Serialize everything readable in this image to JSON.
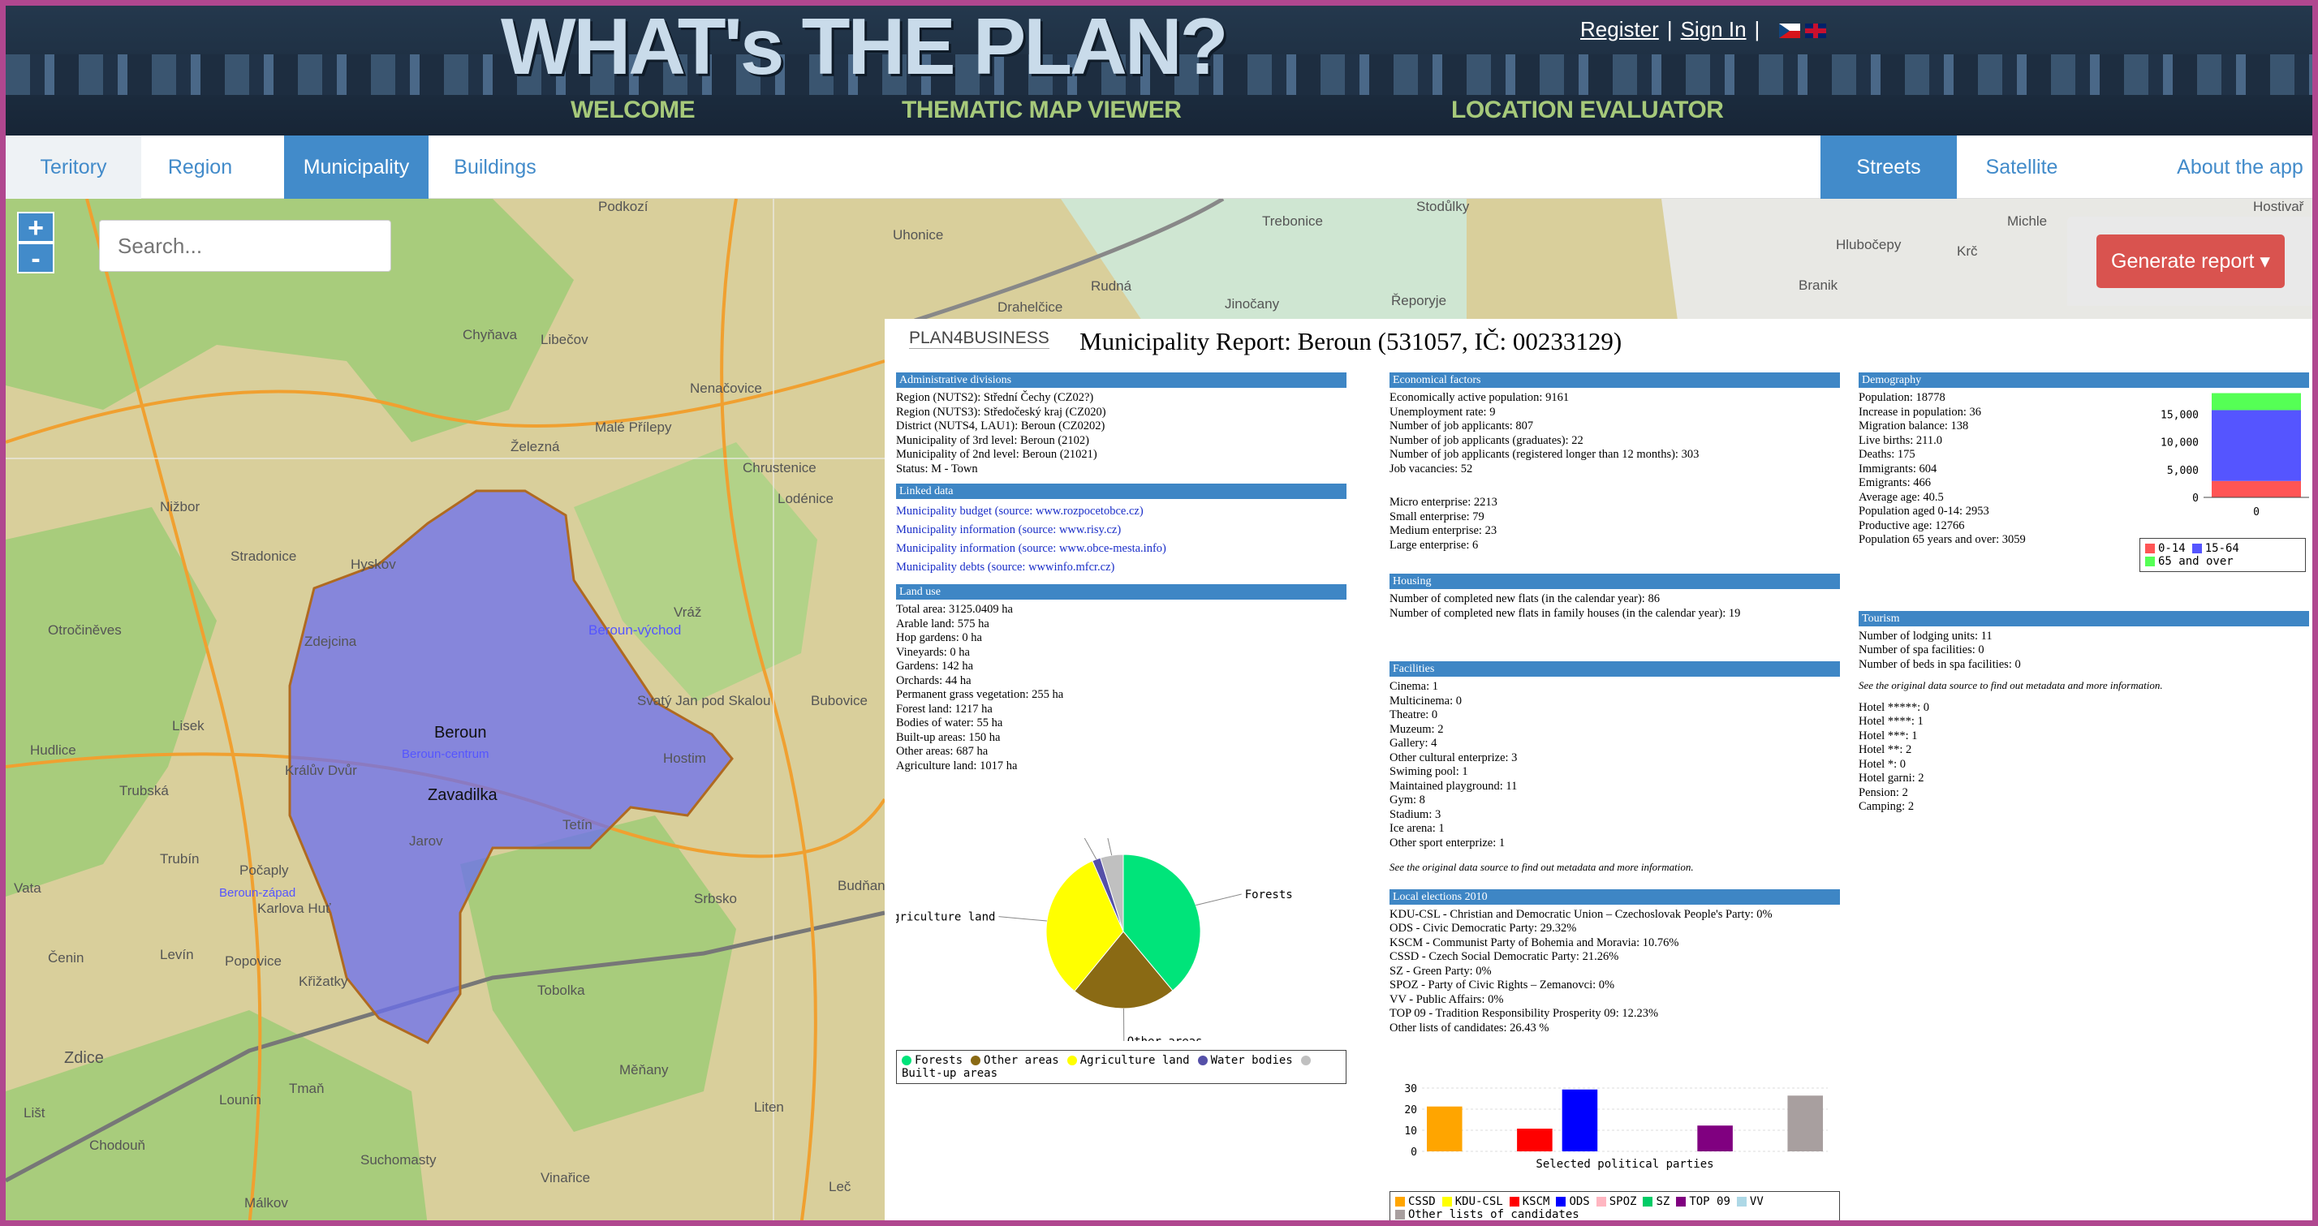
{
  "header": {
    "site_title": "WHAT's THE PLAN?",
    "register": "Register",
    "signin": "Sign In",
    "sep1": "|",
    "sep2": "|",
    "nav": [
      "WELCOME",
      "THEMATIC MAP VIEWER",
      "LOCATION EVALUATOR"
    ]
  },
  "tabs": {
    "left": [
      "Teritory",
      "Region",
      "Municipality",
      "Buildings"
    ],
    "right": [
      "Streets",
      "Satellite",
      "About the app"
    ]
  },
  "map": {
    "search_placeholder": "Search...",
    "zoom_in": "+",
    "zoom_out": "-",
    "generate_report": "Generate report ▾",
    "labels": [
      "Podkozí",
      "Uhonice",
      "Chyňava",
      "Libečov",
      "Nenačovice",
      "Malé Přílepy",
      "Železná",
      "Nižbor",
      "Stradonice",
      "Hyskov",
      "Chrustenice",
      "Lodénice",
      "Otročiněves",
      "Zdejcina",
      "Vráž",
      "Beroun",
      "Beroun-východ",
      "Svatý Jan pod Skalou",
      "Bubovice",
      "Hudlice",
      "Trubská",
      "Zavadilka",
      "Hostim",
      "Králův Dvůr",
      "Jarov",
      "Tetín",
      "Trubín",
      "Počaply",
      "Karlova Huť",
      "Srbsko",
      "Levín",
      "Popovice",
      "Křižatky",
      "Tobolka",
      "Zdice",
      "Měňany",
      "Lounín",
      "Tmaň",
      "Chodouň",
      "Suchomasty",
      "Vinařice",
      "Lišt",
      "Málkov",
      "Leč",
      "Trebonice",
      "Hlubočepy",
      "Krč",
      "Michle",
      "Hostivař",
      "Rudná",
      "Jinočany",
      "Řeporyje",
      "Branik",
      "Drahelčice",
      "Beroun-centrum",
      "Beroun-západ",
      "Vata",
      "Lisek",
      "Čenin",
      "Liten",
      "Budňan",
      "Stodůlky"
    ]
  },
  "report": {
    "logo": "PLAN4BUSINESS",
    "title": "Municipality Report: Beroun (531057, IČ: 00233129)",
    "admin": {
      "header": "Administrative divisions",
      "lines": [
        "Region (NUTS2): Střední Čechy (CZ02?)",
        "Region (NUTS3): Středočeský kraj (CZ020)",
        "District (NUTS4, LAU1): Beroun (CZ0202)",
        "Municipality of 3rd level: Beroun (2102)",
        "Municipality of 2nd level: Beroun (21021)",
        "Status: M - Town"
      ]
    },
    "linked": {
      "header": "Linked data",
      "links": [
        "Municipality budget (source: www.rozpocetobce.cz)",
        "Municipality information (source: www.risy.cz)",
        "Municipality information (source: www.obce-mesta.info)",
        "Municipality debts (source: wwwinfo.mfcr.cz)"
      ]
    },
    "land": {
      "header": "Land use",
      "lines": [
        "Total area: 3125.0409 ha",
        "Arable land: 575 ha",
        "Hop gardens: 0 ha",
        "Vineyards: 0 ha",
        "Gardens: 142 ha",
        "Orchards: 44 ha",
        "Permanent grass vegetation: 255 ha",
        "Forest land: 1217 ha",
        "Bodies of water: 55 ha",
        "Built-up areas: 150 ha",
        "Other areas: 687 ha",
        "Agriculture land: 1017 ha"
      ]
    },
    "econ": {
      "header": "Economical factors",
      "lines": [
        "Economically active population: 9161",
        "Unemployment rate: 9",
        "Number of job applicants: 807",
        "Number of job applicants (graduates): 22",
        "Number of job applicants (registered longer than 12 months): 303",
        "Job vacancies: 52"
      ],
      "lines2": [
        "Micro enterprise: 2213",
        "Small enterprise: 79",
        "Medium enterprise: 23",
        "Large enterprise: 6"
      ]
    },
    "housing": {
      "header": "Housing",
      "lines": [
        "Number of completed new flats (in the calendar year): 86",
        "Number of completed new flats in family houses (in the calendar year): 19"
      ]
    },
    "facilities": {
      "header": "Facilities",
      "lines": [
        "Cinema: 1",
        "Multicinema: 0",
        "Theatre: 0",
        "Muzeum: 2",
        "Gallery: 4",
        "Other cultural enterprize: 3"
      ],
      "lines2": [
        "Swiming pool: 1",
        "Maintained playground: 11",
        "Gym: 8",
        "Stadium: 3",
        "Ice arena: 1",
        "Other sport enterprize: 1"
      ],
      "note": "See the original data source to find out metadata and more information."
    },
    "elections": {
      "header": "Local elections 2010",
      "lines": [
        "KDU-CSL - Christian and Democratic Union – Czechoslovak People's Party: 0%",
        "ODS - Civic Democratic Party: 29.32%",
        "KSCM - Communist Party of Bohemia and Moravia: 10.76%",
        "CSSD - Czech Social Democratic Party: 21.26%",
        "SZ - Green Party: 0%",
        "SPOZ - Party of Civic Rights – Zemanovci: 0%",
        "VV - Public Affairs: 0%",
        "TOP 09 - Tradition Responsibility Prosperity 09: 12.23%",
        "Other lists of candidates: 26.43 %"
      ]
    },
    "demography": {
      "header": "Demography",
      "lines": [
        "Population: 18778",
        "Increase in population: 36",
        "Migration balance: 138",
        "Live births: 211.0",
        "Deaths: 175",
        "Immigrants: 604",
        "Emigrants: 466",
        "Average age: 40.5",
        "Population aged 0-14: 2953",
        "Productive age: 12766",
        "Population 65 years and over: 3059"
      ]
    },
    "tourism": {
      "header": "Tourism",
      "lines": [
        "Number of lodging units: 11",
        "Number of spa facilities: 0",
        "Number of beds in spa facilities: 0"
      ],
      "note": "See the original data source to find out metadata and more information.",
      "lines2": [
        "Hotel *****: 0",
        "Hotel ****: 1",
        "Hotel ***: 1",
        "Hotel **: 2",
        "Hotel *: 0",
        "Hotel garni: 2",
        "Pension: 2",
        "Camping: 2"
      ]
    }
  },
  "chart_data": [
    {
      "type": "pie",
      "labels": [
        "Forests",
        "Other areas",
        "Agriculture land",
        "Water bodies",
        "Built-up areas"
      ],
      "values": [
        1217,
        687,
        1017,
        55,
        150
      ],
      "colors": [
        "#00e47a",
        "#8a6a14",
        "#ffff00",
        "#5550a8",
        "#c0c0c0"
      ],
      "legend_placement": "bottom"
    },
    {
      "type": "bar",
      "xlabel": "Selected political parties",
      "series": [
        {
          "name": "CSSD",
          "values": [
            21.26
          ],
          "color": "#ffa500"
        },
        {
          "name": "KDU-CSL",
          "values": [
            0
          ],
          "color": "#ffff00"
        },
        {
          "name": "KSCM",
          "values": [
            10.76
          ],
          "color": "#ff0000"
        },
        {
          "name": "ODS",
          "values": [
            29.32
          ],
          "color": "#0000ff"
        },
        {
          "name": "SPOZ",
          "values": [
            0
          ],
          "color": "#ffb6c1"
        },
        {
          "name": "SZ",
          "values": [
            0
          ],
          "color": "#00cc66"
        },
        {
          "name": "TOP 09",
          "values": [
            12.23
          ],
          "color": "#800080"
        },
        {
          "name": "VV",
          "values": [
            0
          ],
          "color": "#add8e6"
        },
        {
          "name": "Other lists of candidates",
          "values": [
            26.43
          ],
          "color": "#a89f9f"
        }
      ],
      "ylim": [
        0,
        30
      ],
      "yticks": [
        "0",
        "10",
        "20",
        "30"
      ],
      "grid": true,
      "legend_placement": "bottom"
    },
    {
      "type": "bar",
      "stacked": true,
      "categories": [
        "0"
      ],
      "series": [
        {
          "name": "0-14",
          "values": [
            2953
          ],
          "color": "#ff5555"
        },
        {
          "name": "15-64",
          "values": [
            12766
          ],
          "color": "#5555ff"
        },
        {
          "name": "65 and over",
          "values": [
            3059
          ],
          "color": "#55ff55"
        }
      ],
      "ylim": [
        0,
        19000
      ],
      "yticks": [
        "0",
        "5,000",
        "10,000",
        "15,000"
      ],
      "legend_placement": "bottom"
    }
  ]
}
